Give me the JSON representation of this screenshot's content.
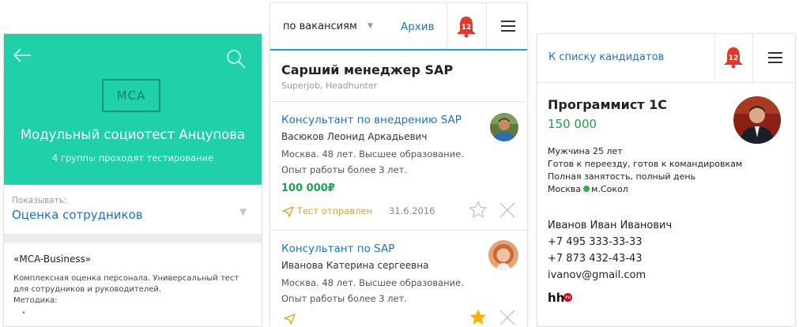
{
  "colors": {
    "teal": "#1fd0a8",
    "link": "#1a73c8",
    "salary": "#1aa34a",
    "sent": "#e6a324",
    "bell": "#e03a2c",
    "star_active": "#f5b300",
    "metro": "#2fb24b"
  },
  "left_card": {
    "icons": [
      "arrow-left-icon",
      "search-icon"
    ],
    "logo_text": "MCA",
    "title": "Модульный социотест Анцупова",
    "subtitle": "4 группы проходят тестирование",
    "show_label": "Показывать:",
    "show_value": "Оценка сотрудников",
    "section_title": "«MCA-Business»",
    "description_lines": [
      "Комплексная оценка персонала. Универсальный тест",
      "для сотрудников и руководителей.",
      "Методика:"
    ]
  },
  "middle_card": {
    "filter_label": "по вакансиям",
    "archive_label": "Архив",
    "bell_count": "12",
    "icons": [
      "bell-icon",
      "menu-icon",
      "send-icon",
      "star-icon",
      "close-icon"
    ],
    "title": "Сарший менеджер SAP",
    "sources": "Superjob, Headhunter",
    "candidates": [
      {
        "job": "Консультант по внедрению SAP",
        "name": "Васюков Леонид Аркадьевич",
        "desc_line1": "Москва. 48 лет. Высшее образование.",
        "desc_line2": "Опыт работы более 3 лет.",
        "salary": "100 000₽",
        "status": "Тест отправлен",
        "date": "31.6.2016"
      },
      {
        "job": "Консультант по SAP",
        "name": "Иванова Катерина сергеевна",
        "desc_line1": "Москва. 48 лет. Высшее образование.",
        "desc_line2": "Опыт работы более 3 лет."
      }
    ]
  },
  "right_card": {
    "back_label": "К списку кандидатов",
    "bell_count": "12",
    "title": "Программист 1С",
    "salary": "150 000",
    "info": {
      "gender_age": "Мужчина  25 лет",
      "relocation": "Готов к переезду, готов к командировкам",
      "schedule": "Полная занятость, полный день",
      "city": "Москва",
      "metro": "м.Сокол"
    },
    "contact": {
      "name": "Иванов Иван Иванович",
      "phone1": "+7 495 333-33-33",
      "phone2": "+7 873 432-43-43",
      "email": "ivanov@gmail.com"
    },
    "logo_text": "hh",
    "logo_badge": "ru"
  }
}
